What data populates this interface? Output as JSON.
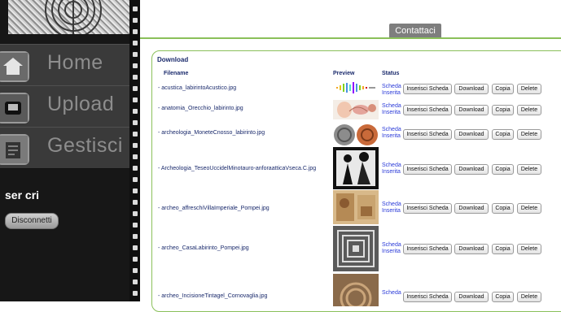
{
  "sidebar": {
    "nav": [
      {
        "label": "Home",
        "icon": "home-icon"
      },
      {
        "label": "Upload",
        "icon": "upload-icon"
      },
      {
        "label": "Gestisci",
        "icon": "manage-icon"
      }
    ],
    "user_name": "ser cri",
    "disconnect_label": "Disconnetti"
  },
  "header": {
    "contact_label": "Contattaci"
  },
  "download": {
    "title": "Download",
    "columns": {
      "filename": "Filename",
      "preview": "Preview",
      "status": "Status"
    },
    "rows": [
      {
        "filename": "- acustica_labirintoAcustico.jpg",
        "status_line1": "Scheda",
        "status_line2": "Inserita"
      },
      {
        "filename": "- anatomia_Orecchio_labirinto.jpg",
        "status_line1": "Scheda",
        "status_line2": "Inserita"
      },
      {
        "filename": "- archeologia_MoneteCnosso_labirinto.jpg",
        "status_line1": "Scheda",
        "status_line2": "Inserita"
      },
      {
        "filename": "- Archeologia_TeseoUccidelMinotauro-anforaatticaVseca.C.jpg",
        "status_line1": "Scheda",
        "status_line2": "Inserita"
      },
      {
        "filename": "- archeo_affreschiVillaImperiale_Pompei.jpg",
        "status_line1": "Scheda",
        "status_line2": "Inserita"
      },
      {
        "filename": "- archeo_CasaLabirinto_Pompei.jpg",
        "status_line1": "Scheda",
        "status_line2": "Inserita"
      },
      {
        "filename": "- archeo_IncisioneTintagel_Cornovaglia.jpg",
        "status_line1": "Scheda",
        "status_line2": ""
      }
    ],
    "buttons": {
      "insert": "Inserisci Scheda",
      "download": "Download",
      "copy": "Copia",
      "delete": "Delete"
    }
  }
}
